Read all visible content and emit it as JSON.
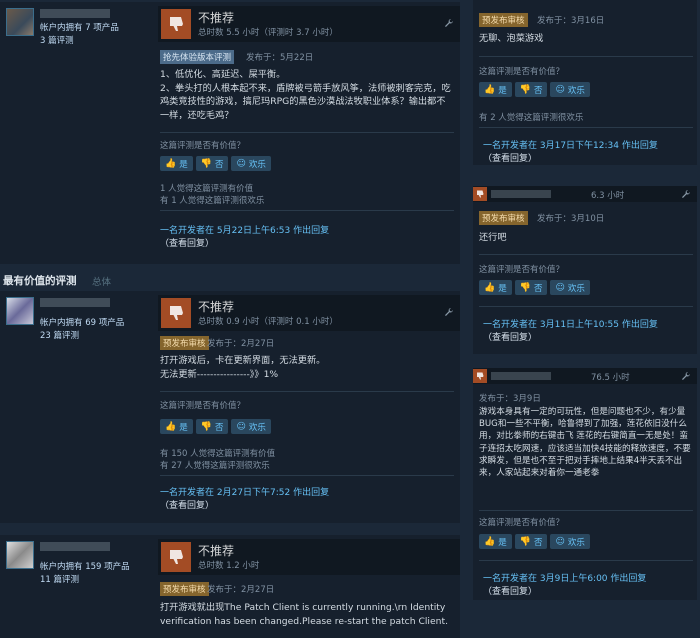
{
  "icons": {
    "thumb_down": "thumbs-down-icon",
    "thumb_up": "thumbs-up-icon",
    "smile": "smile-icon",
    "wrench": "wrench-icon"
  },
  "colors": {
    "thumb_down_bg": "#a34c25",
    "link": "#66c0f4",
    "early_badge": "#4c6b8a",
    "pre_badge": "#85652d"
  },
  "section": {
    "title": "最有价值的评测",
    "subtitle": "总体"
  },
  "vote_labels": {
    "yes": "是",
    "no": "否",
    "funny": "欢乐"
  },
  "helpful_question": "这篇评测是否有价值？",
  "left_reviews": [
    {
      "author_products": "帐户内拥有 7 项产品",
      "author_reviews": "3 篇评测",
      "verdict": "不推荐",
      "hours": "总时数 5.5 小时（评测时 3.7 小时）",
      "badge": "抢先体验版本评测",
      "posted": "发布于：5月22日",
      "body": [
        "1、低优化、高延迟、屎平衡。",
        "2、拳头打的人根本起不来，盾牌被弓箭手放风筝，法师被刺客完克，吃鸡类竞技性的游戏，搞尼玛RPG的黑色沙漠战法牧职业体系？输出都不一样，还吃毛鸡？"
      ],
      "stat1": "1 人觉得这篇评测有价值",
      "stat2": "有 1 人觉得这篇评测很欢乐",
      "dev_reply": "一名开发者在 5月22日上午6:53 作出回复",
      "view_reply": "（查看回复）"
    },
    {
      "author_products": "帐户内拥有 69 项产品",
      "author_reviews": "23 篇评测",
      "verdict": "不推荐",
      "hours": "总时数 0.9 小时（评测时 0.1 小时）",
      "badge": "预发布审核",
      "posted": "发布于：2月27日",
      "body": [
        "打开游戏后，卡在更新界面，无法更新。",
        "无法更新----------------》》1%"
      ],
      "stat1": "有 150 人觉得这篇评测有价值",
      "stat2": "有 27 人觉得这篇评测很欢乐",
      "dev_reply": "一名开发者在 2月27日下午7:52 作出回复",
      "view_reply": "（查看回复）"
    },
    {
      "author_products": "帐户内拥有 159 项产品",
      "author_reviews": "11 篇评测",
      "verdict": "不推荐",
      "hours": "总时数 1.2 小时",
      "badge": "预发布审核",
      "posted": "发布于：2月27日",
      "body": [
        "打开游戏就出现The Patch Client is currently running.\\rn Identity verification has been changed.Please re-start the patch Client."
      ]
    }
  ],
  "right_reviews": [
    {
      "badge": "预发布审核",
      "posted": "发布于：3月16日",
      "body": [
        "无聊、泡菜游戏"
      ],
      "stat": "有 2 人觉得这篇评测很欢乐",
      "dev_reply": "一名开发者在 3月17日下午12:34 作出回复",
      "view_reply": "（查看回复）"
    },
    {
      "hours": "6.3 小时",
      "badge": "预发布审核",
      "posted": "发布于：3月10日",
      "body": [
        "还行吧"
      ],
      "dev_reply": "一名开发者在 3月11日上午10:55 作出回复",
      "view_reply": "（查看回复）"
    },
    {
      "hours": "76.5 小时",
      "posted": "发布于：3月9日",
      "body": [
        "游戏本身具有一定的可玩性，但是问题也不少，有少量BUG和一些不平衡，哈鲁得到了加强，莲花依旧没什么用，对比拳师的右键击飞 莲花的右键简直一无是处！蛮子连招太吃网速，应该适当加快4技能的释放速度，不要求瞬发，但是也不至于把对手摔地上结果4半天丢不出来，人家站起来对着你一通老拳"
      ],
      "dev_reply": "一名开发者在 3月9日上午6:00 作出回复",
      "view_reply": "（查看回复）"
    }
  ]
}
